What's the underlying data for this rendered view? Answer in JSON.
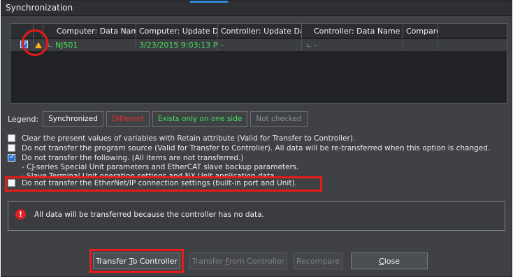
{
  "window": {
    "title": "Synchronization"
  },
  "grid": {
    "headers": [
      "Computer: Data Name",
      "Computer: Update Da",
      "Controller: Update Da",
      "Controller: Data Name",
      "Compare"
    ],
    "row": {
      "checked": true,
      "computer_name": "NJ501",
      "computer_update": "3/23/2015 9:03:13 PM",
      "controller_update": "-",
      "controller_name": "-",
      "compare": ""
    }
  },
  "legend": {
    "label": "Legend:",
    "items": [
      "Synchronized",
      "Different",
      "Exists only on one side",
      "Not checked"
    ],
    "colors": {
      "synchronized": "#ffffff",
      "different": "#e03232",
      "one_side": "#44e35b",
      "not_checked": "#8c8f93"
    }
  },
  "options": {
    "opt1": "Clear the present values of variables with Retain attribute (Valid for Transfer to Controller).",
    "opt2": "Do not transfer the program source (Valid for Transfer to Controller). All data will be re-transferred when this option is changed.",
    "opt3": "Do not transfer the following. (All items are not transferred.)",
    "opt3_sub1": "- CJ-series Special Unit parameters and EtherCAT slave backup parameters.",
    "opt3_sub2": "- Slave Terminal Unit operation settings and NX Unit application data.",
    "opt4": "Do not transfer the EtherNet/IP connection settings (built-in port and Unit).",
    "opt1_checked": false,
    "opt2_checked": false,
    "opt3_checked": true,
    "opt4_checked": false
  },
  "message": {
    "icon": "error-icon",
    "text": "All data will be transferred because the controller has no data."
  },
  "buttons": {
    "transfer_to": {
      "pre": "Transfer ",
      "key": "T",
      "post": "o Controller"
    },
    "transfer_from": {
      "pre": "Transfer ",
      "key": "F",
      "post": "rom Controller"
    },
    "recompare": "Recompare",
    "close": {
      "key": "C",
      "post": "lose"
    }
  }
}
